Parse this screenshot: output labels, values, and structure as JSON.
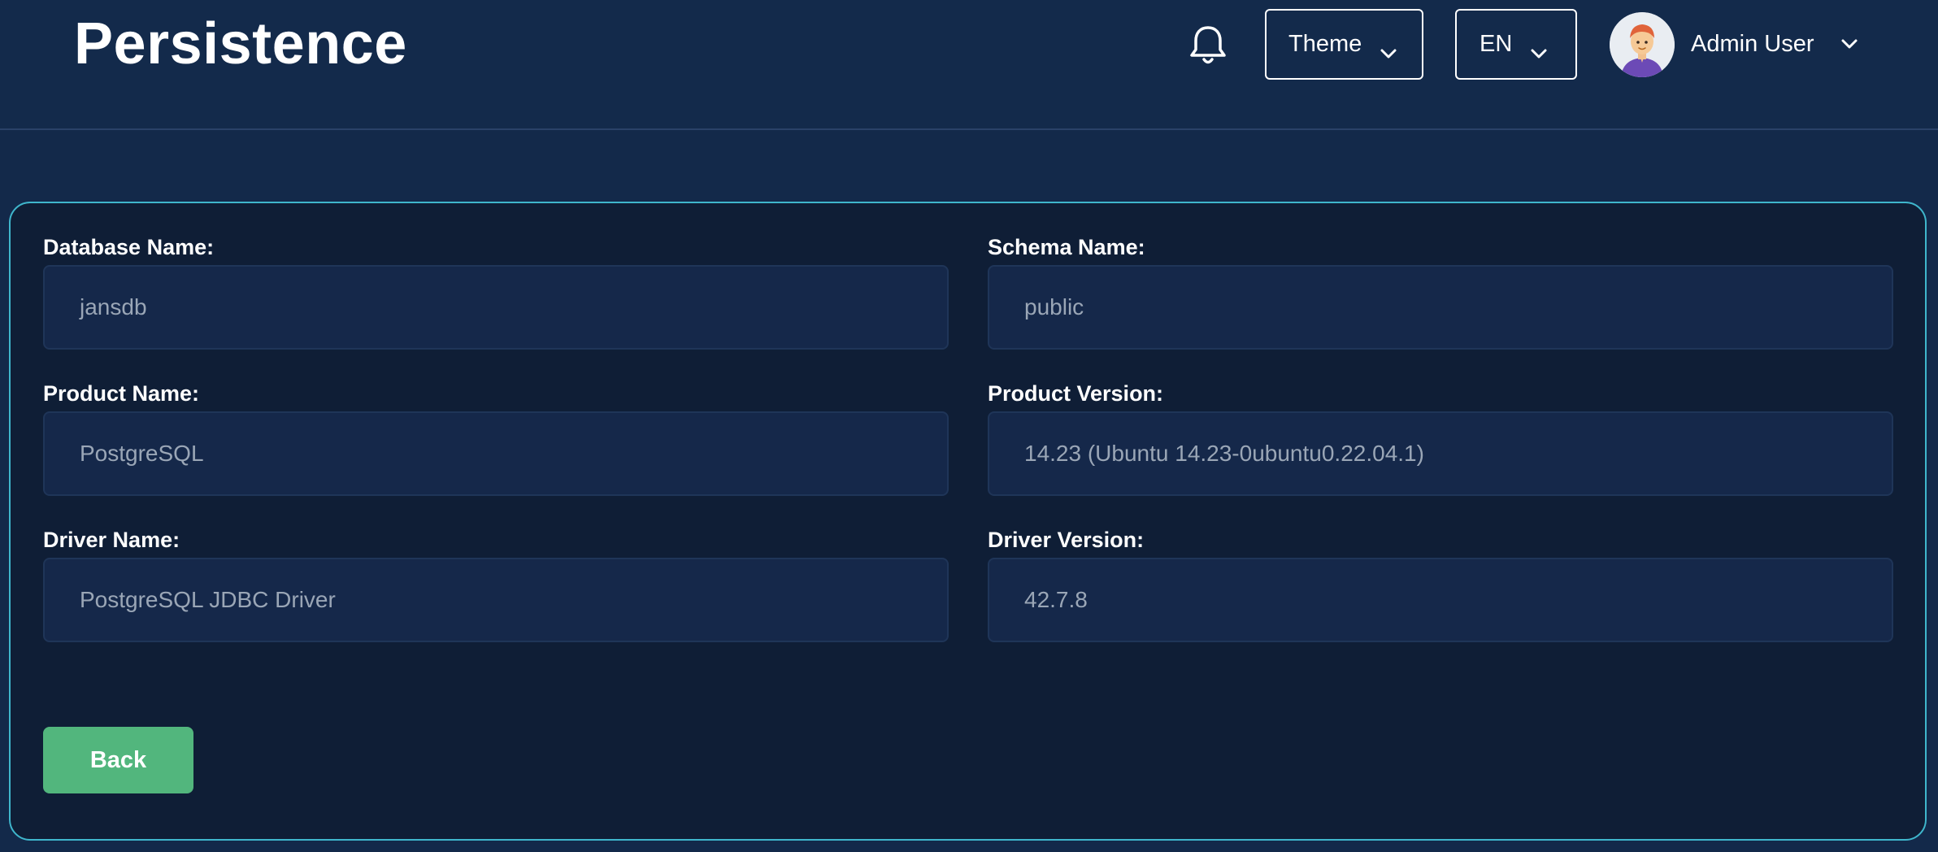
{
  "header": {
    "title": "Persistence",
    "theme_label": "Theme",
    "language_label": "EN",
    "user_name": "Admin User"
  },
  "icons": {
    "notifications": "bell-icon",
    "theme_dropdown": "chevron-down-icon",
    "language_dropdown": "chevron-down-icon",
    "user_menu": "chevron-down-icon",
    "avatar": "user-avatar"
  },
  "form": {
    "database_name": {
      "label": "Database Name:",
      "value": "jansdb"
    },
    "schema_name": {
      "label": "Schema Name:",
      "value": "public"
    },
    "product_name": {
      "label": "Product Name:",
      "value": "PostgreSQL"
    },
    "product_version": {
      "label": "Product Version:",
      "value": "14.23 (Ubuntu 14.23-0ubuntu0.22.04.1)"
    },
    "driver_name": {
      "label": "Driver Name:",
      "value": "PostgreSQL JDBC Driver"
    },
    "driver_version": {
      "label": "Driver Version:",
      "value": "42.7.8"
    }
  },
  "actions": {
    "back_label": "Back"
  },
  "colors": {
    "background": "#13294a",
    "card": "#0f1e36",
    "card_border": "#3fb6cc",
    "input_bg": "#15284a",
    "input_text": "#9aa6b6",
    "back_button": "#52b67d"
  }
}
